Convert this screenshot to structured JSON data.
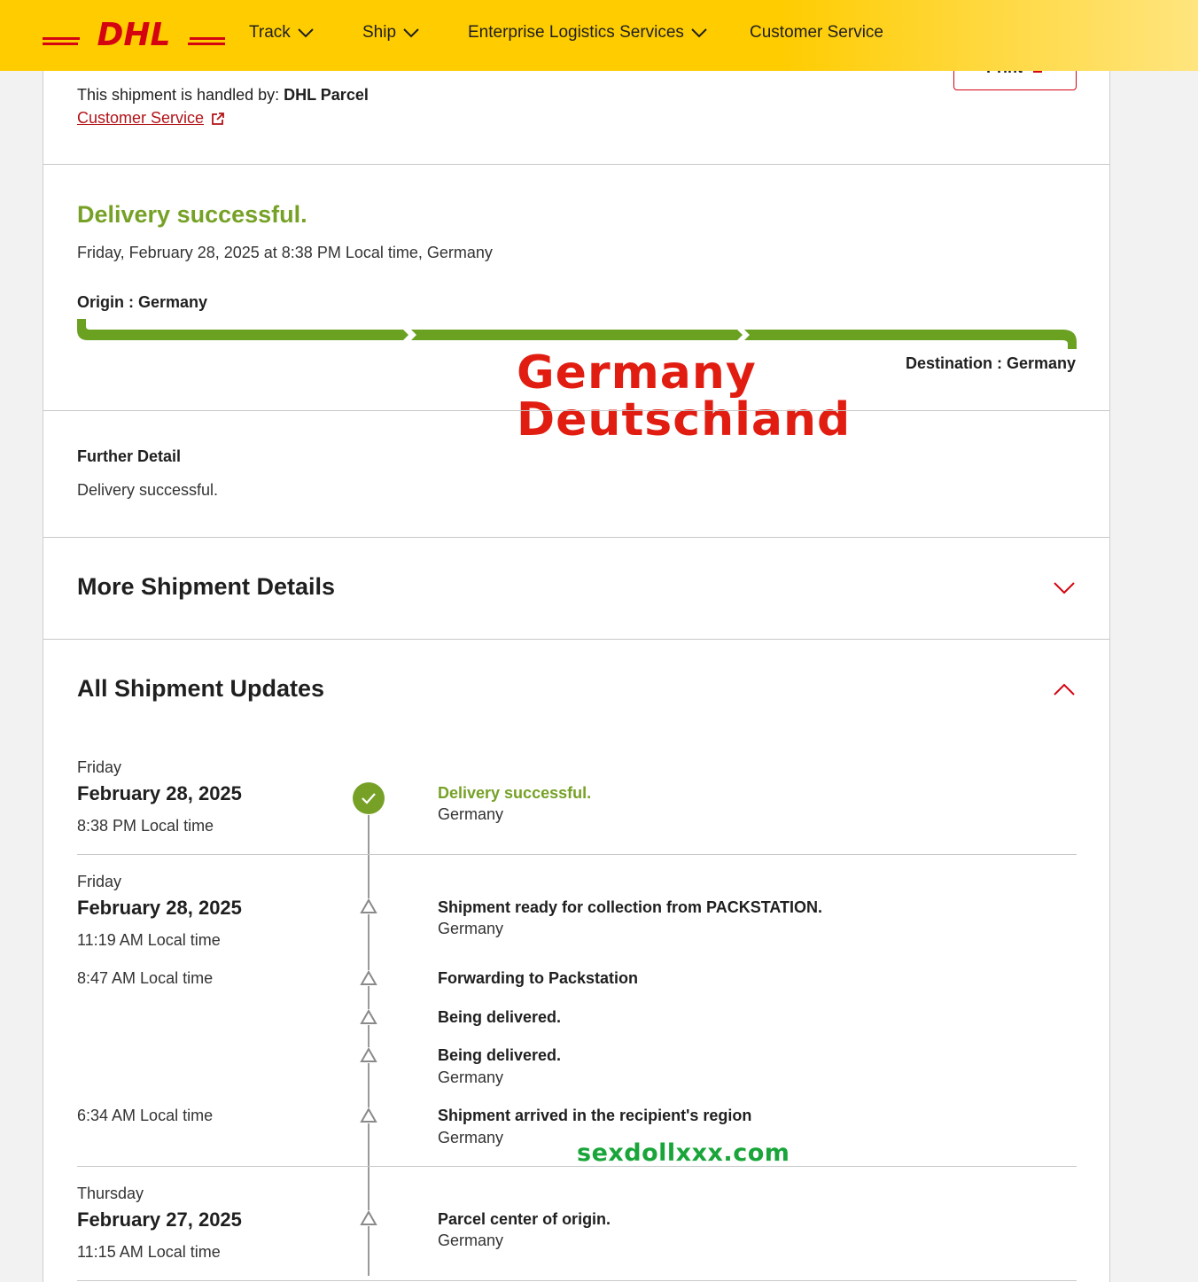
{
  "header": {
    "logo_text": "DHL",
    "nav": [
      {
        "label": "Track",
        "has_menu": true
      },
      {
        "label": "Ship",
        "has_menu": true
      },
      {
        "label": "Enterprise Logistics Services",
        "has_menu": true
      },
      {
        "label": "Customer Service",
        "has_menu": false
      }
    ],
    "brand_yellow": "#ffcc00",
    "brand_red": "#d40511"
  },
  "shipment": {
    "print_label": "Print",
    "handled_prefix": "This shipment is handled by: ",
    "handled_by": "DHL Parcel",
    "customer_service_link": "Customer Service",
    "status_title": "Delivery successful.",
    "status_time": "Friday, February 28, 2025 at 8:38 PM Local time, Germany",
    "origin": "Origin : Germany",
    "destination": "Destination : Germany",
    "progress_segments_complete": 3,
    "progress_segments_total": 3,
    "status_color": "#76a126"
  },
  "overlay": {
    "line1": "Germany",
    "line2": "Deutschland",
    "url": "sexdollxxx.com"
  },
  "further": {
    "title": "Further Detail",
    "text": "Delivery successful."
  },
  "sections": {
    "more_details": "More Shipment Details",
    "all_updates": "All Shipment Updates"
  },
  "updates": {
    "groups": [
      {
        "day": "Friday",
        "date": "February 28, 2025",
        "events": [
          {
            "time": "8:38 PM Local time",
            "title": "Delivery successful.",
            "location": "Germany",
            "status": "delivered"
          }
        ]
      },
      {
        "day": "Friday",
        "date": "February 28, 2025",
        "events": [
          {
            "time": "11:19 AM Local time",
            "title": "Shipment ready for collection from PACKSTATION.",
            "location": "Germany"
          },
          {
            "time": "8:47 AM Local time",
            "title": "Forwarding to Packstation",
            "location": ""
          },
          {
            "time": "",
            "title": "Being delivered.",
            "location": ""
          },
          {
            "time": "",
            "title": "Being delivered.",
            "location": "Germany"
          },
          {
            "time": "6:34 AM Local time",
            "title": "Shipment arrived in the recipient's region",
            "location": "Germany"
          }
        ]
      },
      {
        "day": "Thursday",
        "date": "February 27, 2025",
        "events": [
          {
            "time": "11:15 AM Local time",
            "title": "Parcel center of origin.",
            "location": "Germany"
          }
        ]
      }
    ]
  }
}
